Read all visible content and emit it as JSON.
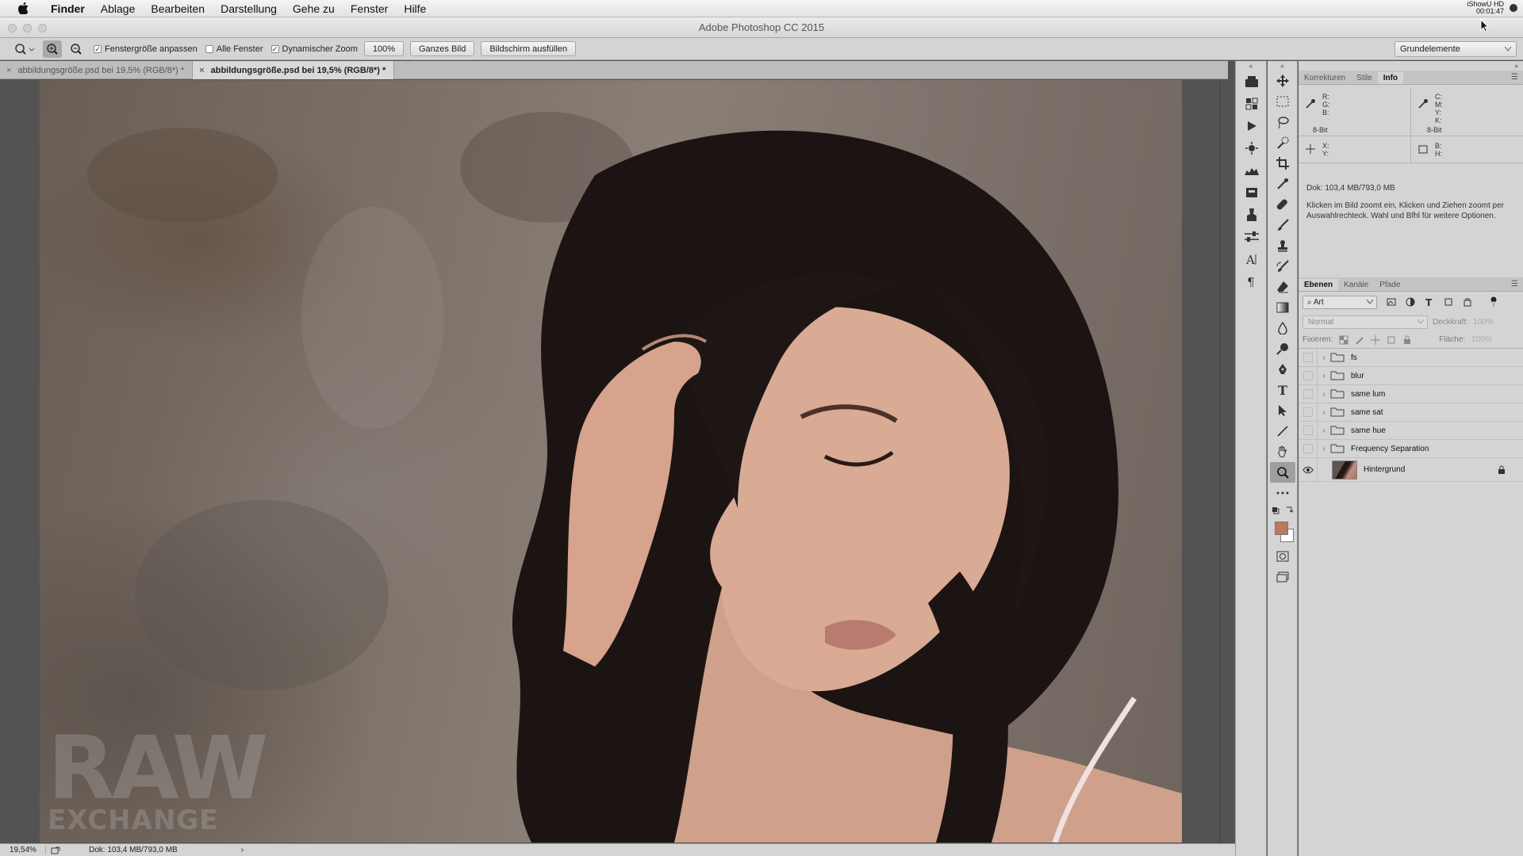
{
  "menubar": {
    "items": [
      "Finder",
      "Ablage",
      "Bearbeiten",
      "Darstellung",
      "Gehe zu",
      "Fenster",
      "Hilfe"
    ],
    "right_line1": "iShowU HD",
    "right_line2": "00:01:47"
  },
  "window": {
    "title": "Adobe Photoshop CC 2015"
  },
  "options": {
    "fit_window": "Fenstergröße anpassen",
    "fit_window_checked": true,
    "all_windows": "Alle Fenster",
    "all_windows_checked": false,
    "scrubby_zoom": "Dynamischer Zoom",
    "scrubby_zoom_checked": true,
    "btn_100": "100%",
    "btn_fit": "Ganzes Bild",
    "btn_fill": "Bildschirm ausfüllen",
    "workspace": "Grundelemente"
  },
  "tabs": [
    {
      "label": "abbildungsgröße.psd bei 19,5% (RGB/8*) *"
    },
    {
      "label": "abbildungsgröße.psd bei 19,5% (RGB/8*) *"
    }
  ],
  "status": {
    "zoom": "19,54%",
    "doc": "Dok: 103,4 MB/793,0 MB",
    "arrow": "›"
  },
  "info_panel": {
    "tabs": [
      "Korrekturen",
      "Stile",
      "Info"
    ],
    "rgb": "R:\nG:\nB:",
    "bitdepth_left": "8-Bit",
    "cmyk": "C:\nM:\nY:\nK:",
    "bitdepth_right": "8-Bit",
    "xy": "X:\nY:",
    "wh": "B:\nH:",
    "doc": "Dok: 103,4 MB/793,0 MB",
    "hint": "Klicken im Bild zoomt ein, Klicken und Ziehen zoomt per Auswahlrechteck. Wahl und Bfhl für weitere Optionen."
  },
  "layers_panel": {
    "tabs": [
      "Ebenen",
      "Kanäle",
      "Pfade"
    ],
    "kind": "Art",
    "blend_mode": "Normal",
    "opacity_label": "Deckkraft:",
    "opacity": "100%",
    "lock_label": "Fixieren:",
    "fill_label": "Fläche:",
    "fill": "100%",
    "layers": [
      "fs",
      "blur",
      "same lum",
      "same sat",
      "same hue",
      "Frequency Separation"
    ],
    "background": "Hintergrund"
  },
  "watermark": {
    "line1": "RAW",
    "line2": "EXCHANGE"
  },
  "colors": {
    "foreground": "#b97a5e",
    "background": "#ffffff"
  }
}
